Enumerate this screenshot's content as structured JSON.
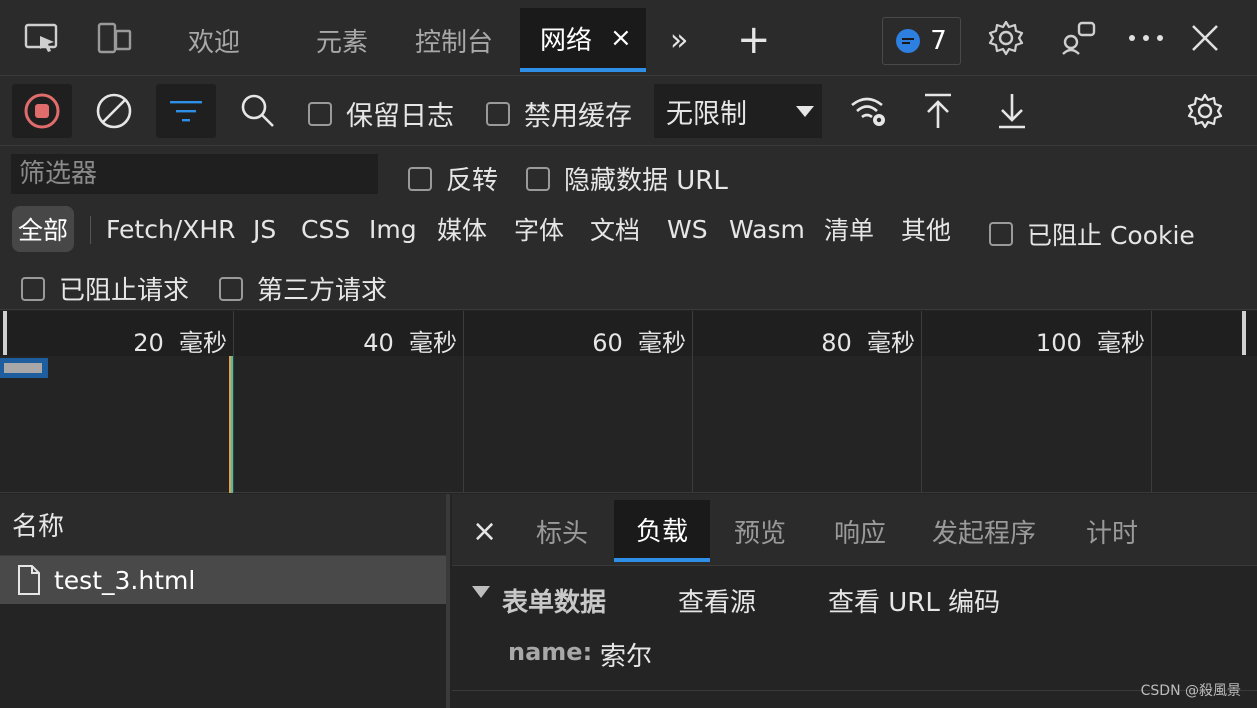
{
  "tabs": {
    "welcome": "欢迎",
    "elements": "元素",
    "console": "控制台",
    "network": "网络",
    "close": "×",
    "more": "»",
    "add": "+"
  },
  "issues_count": "7",
  "toolbar": {
    "preserve_log": "保留日志",
    "disable_cache": "禁用缓存",
    "throttle": "无限制"
  },
  "filter": {
    "placeholder": "筛选器",
    "invert": "反转",
    "hide_data_url": "隐藏数据 URL",
    "types": [
      "全部",
      "Fetch/XHR",
      "JS",
      "CSS",
      "Img",
      "媒体",
      "字体",
      "文档",
      "WS",
      "Wasm",
      "清单",
      "其他"
    ],
    "blocked_cookies": "已阻止 Cookie",
    "blocked_requests": "已阻止请求",
    "third_party": "第三方请求"
  },
  "timeline": {
    "ticks": [
      "20  毫秒",
      "40  毫秒",
      "60  毫秒",
      "80  毫秒",
      "100  毫秒"
    ]
  },
  "requests": {
    "header": "名称",
    "items": [
      "test_3.html"
    ]
  },
  "detail": {
    "close": "×",
    "tabs": [
      "标头",
      "负载",
      "预览",
      "响应",
      "发起程序",
      "计时"
    ],
    "section_title": "表单数据",
    "view_source": "查看源",
    "view_url_encoded": "查看 URL 编码",
    "field_key": "name:",
    "field_value": "索尔"
  },
  "watermark": "CSDN @殺風景",
  "colors": {
    "accent": "#2f8ee6",
    "record": "#e06c6c",
    "badge": "#2d7fe0"
  }
}
